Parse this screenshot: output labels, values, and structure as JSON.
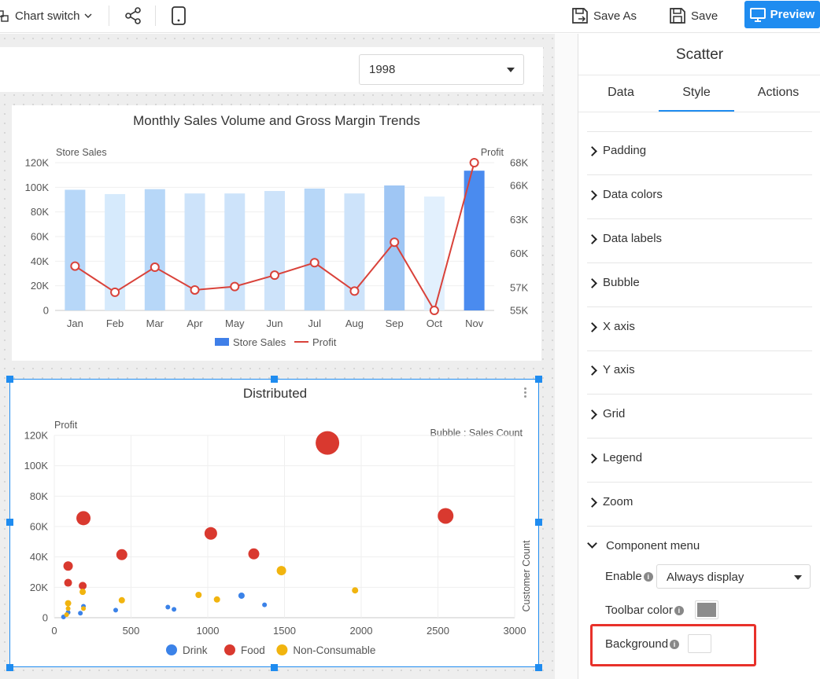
{
  "toolbar": {
    "chart_switch": "Chart switch",
    "save_as": "Save As",
    "save": "Save",
    "preview": "Preview"
  },
  "filter": {
    "year": "1998"
  },
  "bar_line_chart": {
    "title": "Monthly Sales Volume and Gross Margin Trends",
    "left_axis_title": "Store Sales",
    "right_axis_title": "Profit",
    "legend": [
      "Store Sales",
      "Profit"
    ],
    "chart_data": {
      "type": "bar",
      "categories": [
        "Jan",
        "Feb",
        "Mar",
        "Apr",
        "May",
        "Jun",
        "Jul",
        "Aug",
        "Sep",
        "Oct",
        "Nov"
      ],
      "series": [
        {
          "name": "Store Sales",
          "type": "bar",
          "axis": "left",
          "values": [
            98000,
            94500,
            98500,
            95000,
            95000,
            97000,
            99000,
            95000,
            101500,
            92500,
            113500
          ]
        },
        {
          "name": "Profit",
          "type": "line",
          "axis": "right",
          "values": [
            58900,
            56600,
            58800,
            56800,
            57100,
            58100,
            59200,
            56700,
            61000,
            55000,
            68000
          ]
        }
      ],
      "left_ticks": [
        "0",
        "20K",
        "40K",
        "60K",
        "80K",
        "100K",
        "120K"
      ],
      "left_ylim": [
        0,
        120000
      ],
      "right_ticks": [
        "55K",
        "57K",
        "60K",
        "63K",
        "66K",
        "68K"
      ],
      "right_ylim": [
        55000,
        68000
      ],
      "bar_colors": [
        "#b7d7f8",
        "#d6eafc",
        "#b7d7f8",
        "#cde3fa",
        "#cde3fa",
        "#cde3fa",
        "#b7d7f8",
        "#cde3fa",
        "#9fc6f4",
        "#e2f0fd",
        "#4a8bef"
      ],
      "line_color": "#d9423a",
      "legend_color_bar": "#3f7fe8",
      "grid": true
    }
  },
  "scatter_chart": {
    "title": "Distributed",
    "y_axis_title": "Profit",
    "bubble_note": "Bubble : Sales Count",
    "right_axis_title": "Customer Count",
    "chart_data": {
      "type": "scatter",
      "x_ticks": [
        "0",
        "500",
        "1000",
        "1500",
        "2000",
        "2500",
        "3000"
      ],
      "xlim": [
        0,
        3000
      ],
      "y_ticks": [
        "0",
        "20K",
        "40K",
        "60K",
        "80K",
        "100K",
        "120K"
      ],
      "ylim": [
        0,
        120000
      ],
      "legend_placement": "bottom",
      "grid": true,
      "series": [
        {
          "name": "Drink",
          "color": "#3b82e8",
          "points": [
            [
              60,
              500,
              3
            ],
            [
              90,
              3500,
              3
            ],
            [
              170,
              3000,
              3
            ],
            [
              190,
              7500,
              3
            ],
            [
              400,
              5000,
              3
            ],
            [
              740,
              7000,
              3
            ],
            [
              780,
              5500,
              3
            ],
            [
              1220,
              14500,
              4
            ],
            [
              1370,
              8500,
              3
            ]
          ]
        },
        {
          "name": "Food",
          "color": "#d9392f",
          "points": [
            [
              90,
              34000,
              6
            ],
            [
              90,
              23000,
              5
            ],
            [
              185,
              21000,
              5
            ],
            [
              190,
              65500,
              9
            ],
            [
              440,
              41500,
              7
            ],
            [
              1020,
              55500,
              8
            ],
            [
              1300,
              42000,
              7
            ],
            [
              1780,
              115000,
              15
            ],
            [
              2550,
              67000,
              10
            ]
          ]
        },
        {
          "name": "Non-Consumable",
          "color": "#f1b40f",
          "points": [
            [
              90,
              9500,
              4
            ],
            [
              90,
              6000,
              3
            ],
            [
              80,
              2000,
              3
            ],
            [
              185,
              17000,
              4
            ],
            [
              190,
              6000,
              3
            ],
            [
              440,
              11500,
              4
            ],
            [
              940,
              15000,
              4
            ],
            [
              1060,
              12000,
              4
            ],
            [
              1480,
              31000,
              6
            ],
            [
              1960,
              18000,
              4
            ]
          ]
        }
      ]
    }
  },
  "panel": {
    "title": "Scatter",
    "tabs": [
      "Data",
      "Style",
      "Actions"
    ],
    "active_tab": "Style",
    "sections": [
      "Padding",
      "Data colors",
      "Data labels",
      "Bubble",
      "X axis",
      "Y axis",
      "Grid",
      "Legend",
      "Zoom"
    ],
    "component_menu": {
      "label": "Component menu",
      "enable_label": "Enable",
      "enable_value": "Always display",
      "toolbar_color_label": "Toolbar color",
      "toolbar_color": "#8c8c8c",
      "background_label": "Background",
      "background_color": "#ffffff"
    }
  }
}
